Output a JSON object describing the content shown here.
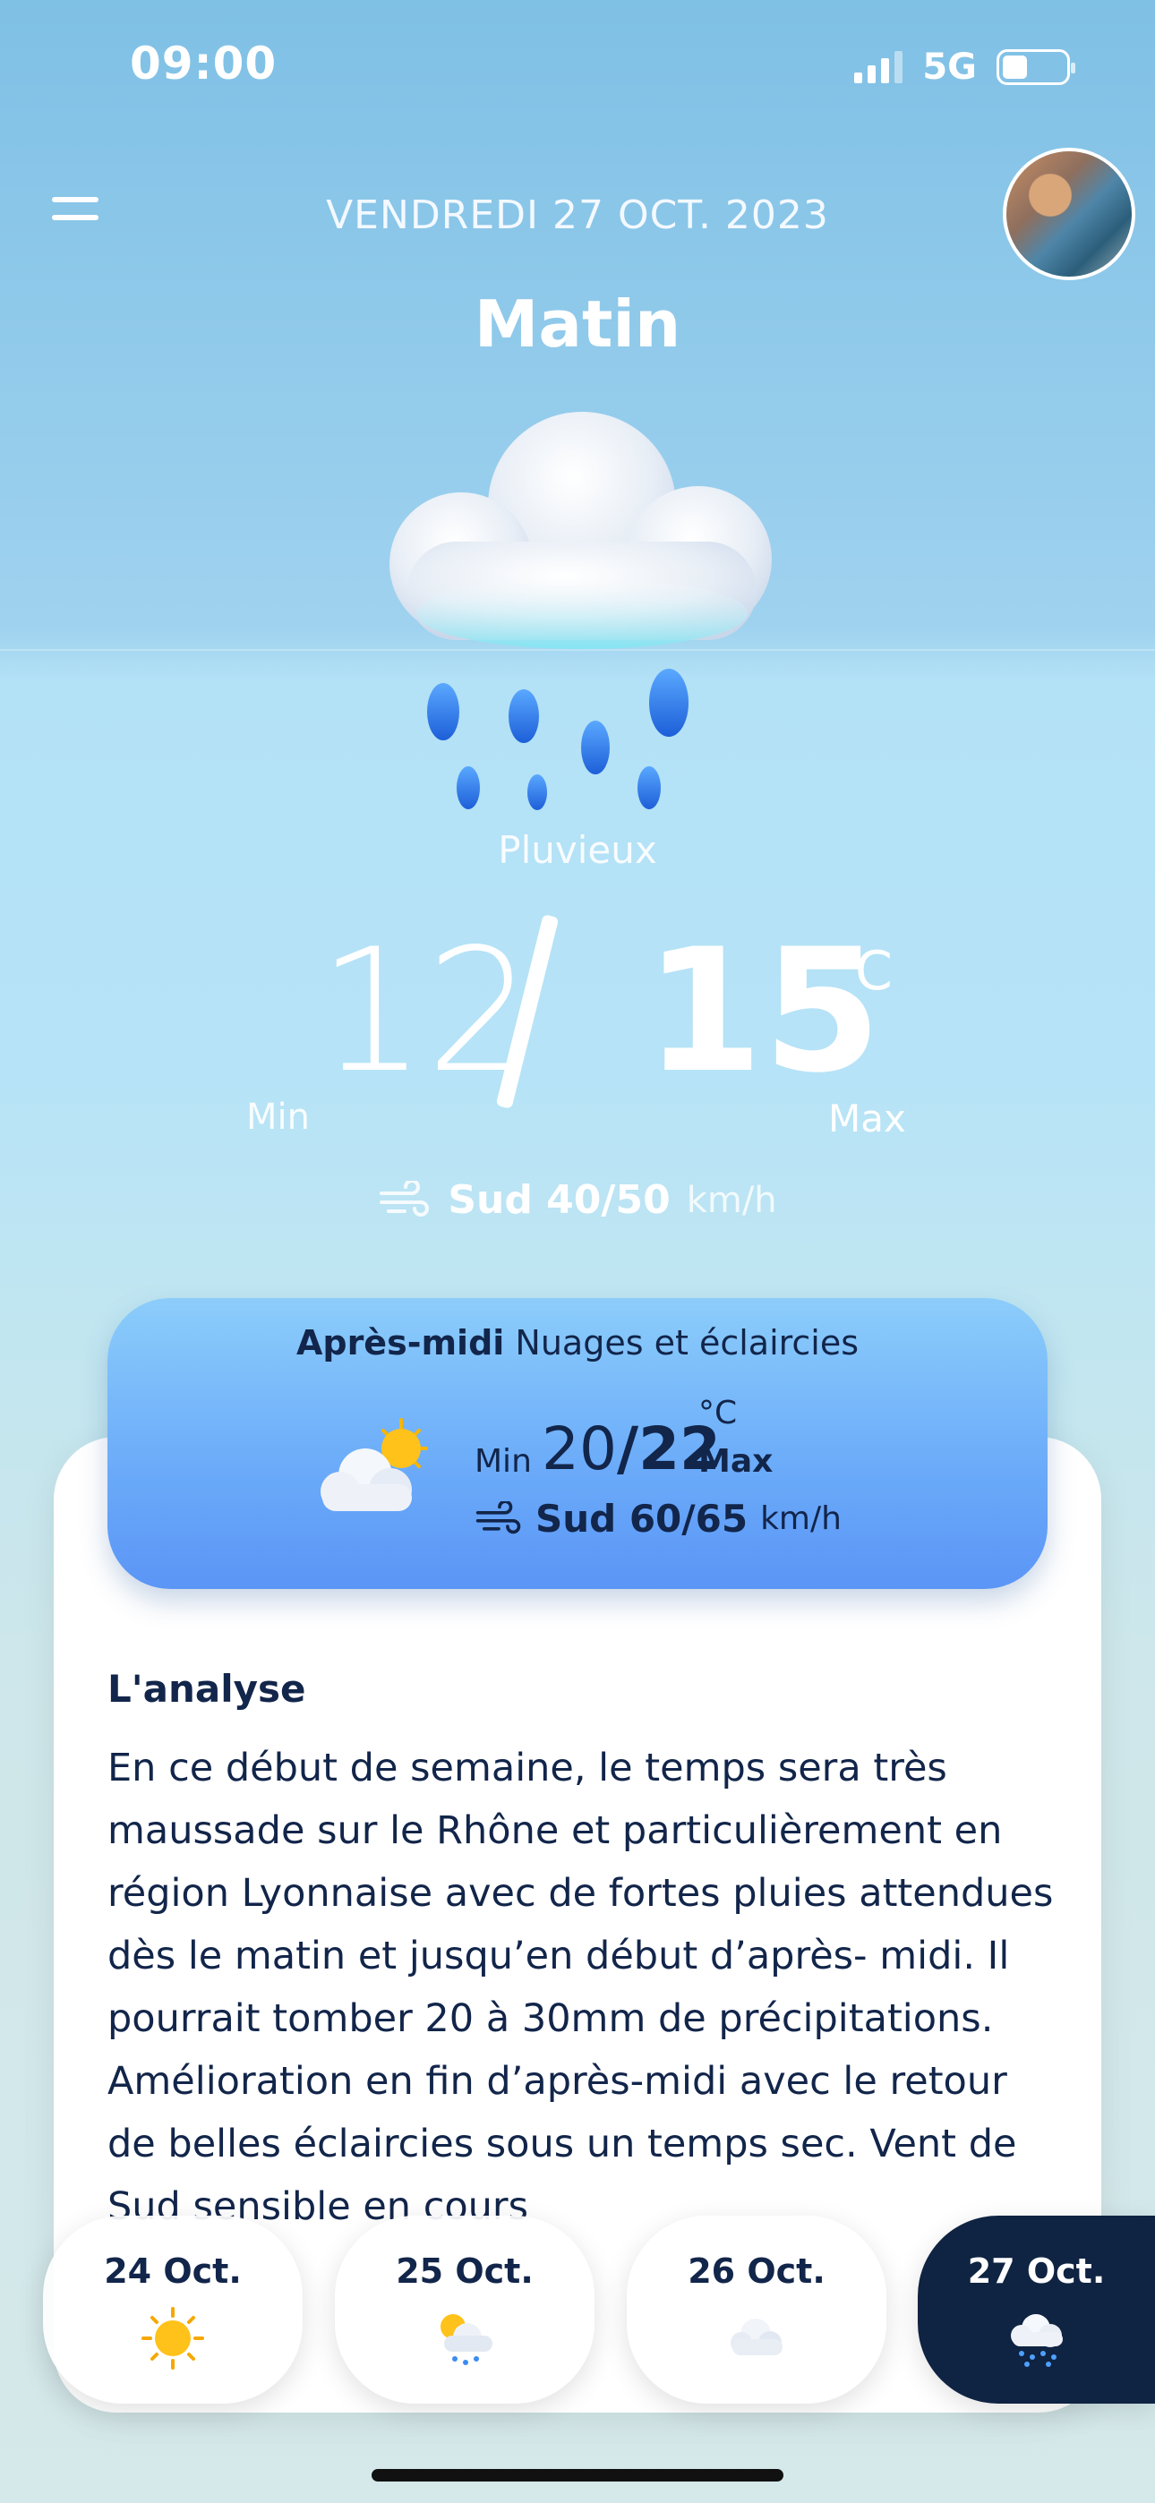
{
  "status_bar": {
    "time": "09:00",
    "network": "5G",
    "signal_bars": 3,
    "battery_level": 0.4
  },
  "header": {
    "date": "VENDREDI 27 OCT. 2023",
    "period": "Matin"
  },
  "icons": {
    "menu": "menu-icon",
    "avatar": "profile-photo",
    "main_weather": "rain-cloud-icon",
    "wind": "wind-icon"
  },
  "current": {
    "condition": "Pluvieux",
    "temp_min": "12",
    "temp_max": "15",
    "unit": "°C",
    "min_label": "Min",
    "max_label": "Max",
    "wind_dir_speed": "Sud 40/50",
    "wind_unit": "km/h"
  },
  "afternoon": {
    "label": "Après-midi",
    "condition": "Nuages et éclaircies",
    "min_label": "Min",
    "temp_min": "20",
    "temp_sep": "/",
    "temp_max": "22",
    "unit": "°C",
    "max_label": "Max",
    "wind_dir_speed": "Sud 60/65",
    "wind_unit": "km/h"
  },
  "analysis": {
    "title": "L'analyse",
    "text": "En ce début de semaine, le temps sera très maussade sur le Rhône et particulièrement en région Lyonnaise avec de fortes pluies attendues dès le matin et jusqu’en début d’après- midi. Il pourrait tomber 20 à 30mm de précipitations. Amélioration en fin d’après-midi avec le retour de belles éclaircies sous un temps sec. Vent de Sud sensible en cours"
  },
  "days": [
    {
      "label": "24 Oct.",
      "icon": "sun-icon"
    },
    {
      "label": "25 Oct.",
      "icon": "sun-rain-icon"
    },
    {
      "label": "26 Oct.",
      "icon": "cloud-icon"
    },
    {
      "label": "27 Oct.",
      "icon": "rain-cloud-icon",
      "active": true
    }
  ],
  "colors": {
    "navy": "#12254a",
    "active_tab": "#0f2342",
    "card_blue": "#6aaaf9"
  }
}
